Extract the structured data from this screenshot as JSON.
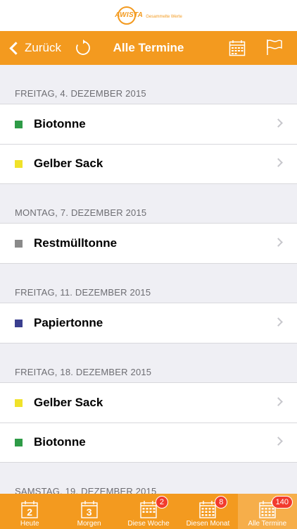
{
  "logo": {
    "name": "AWISTA",
    "tagline": "Gesammelte Werte"
  },
  "nav": {
    "back_label": "Zurück",
    "title": "Alle Termine"
  },
  "sections": [
    {
      "date": "FREITAG, 4. DEZEMBER 2015",
      "items": [
        {
          "label": "Biotonne",
          "color": "#2e9b47"
        },
        {
          "label": "Gelber Sack",
          "color": "#f0e22a"
        }
      ]
    },
    {
      "date": "MONTAG, 7. DEZEMBER 2015",
      "items": [
        {
          "label": "Restmülltonne",
          "color": "#8a8a8a"
        }
      ]
    },
    {
      "date": "FREITAG, 11. DEZEMBER 2015",
      "items": [
        {
          "label": "Papiertonne",
          "color": "#3a3f8f"
        }
      ]
    },
    {
      "date": "FREITAG, 18. DEZEMBER 2015",
      "items": [
        {
          "label": "Gelber Sack",
          "color": "#f0e22a"
        },
        {
          "label": "Biotonne",
          "color": "#2e9b47"
        }
      ]
    },
    {
      "date": "SAMSTAG, 19. DEZEMBER 2015",
      "items": []
    }
  ],
  "tabs": [
    {
      "label": "Heute",
      "icon": "calendar-day-icon",
      "day": "2",
      "badge": ""
    },
    {
      "label": "Morgen",
      "icon": "calendar-day-icon",
      "day": "3",
      "badge": ""
    },
    {
      "label": "Diese Woche",
      "icon": "calendar-week-icon",
      "day": "",
      "badge": "2"
    },
    {
      "label": "Diesen Monat",
      "icon": "calendar-month-icon",
      "day": "",
      "badge": "8"
    },
    {
      "label": "Alle Termine",
      "icon": "calendar-all-icon",
      "day": "",
      "badge": "140",
      "active": true
    }
  ],
  "colors": {
    "accent": "#f39a1f",
    "badge": "#f23b2d"
  }
}
